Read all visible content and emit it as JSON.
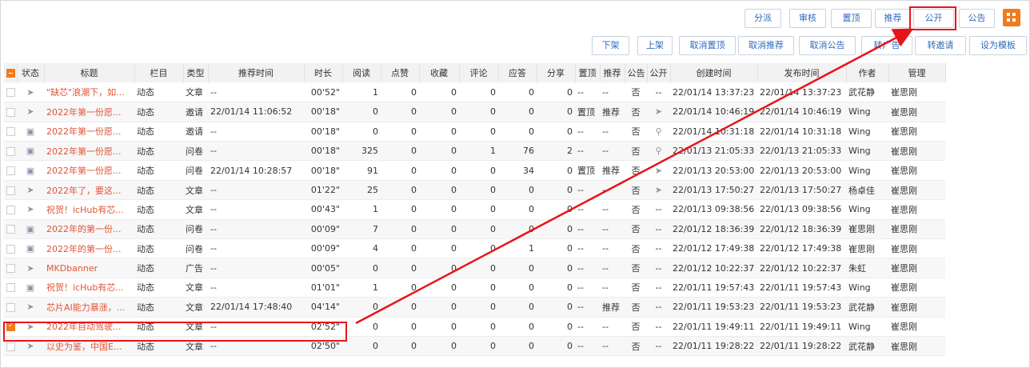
{
  "toolbar_top": [
    "分派",
    "审核",
    "置顶",
    "推荐",
    "公开",
    "公告"
  ],
  "toolbar_bottom": [
    "下架",
    "上架",
    "取消置顶",
    "取消推荐",
    "取消公告",
    "转广告",
    "转邀请",
    "设为模板"
  ],
  "columns": [
    "状态",
    "标题",
    "栏目",
    "类型",
    "推荐时间",
    "时长",
    "阅读",
    "点赞",
    "收藏",
    "评论",
    "应答",
    "分享",
    "置顶",
    "推荐",
    "公告",
    "公开",
    "创建时间",
    "发布时间",
    "作者",
    "管理"
  ],
  "rows": [
    {
      "checked": false,
      "status_icon": "send-icon",
      "title": "\"缺芯\"浪潮下，如...",
      "column": "动态",
      "type": "文章",
      "rec_time": "--",
      "duration": "00'52\"",
      "read": "1",
      "like": "0",
      "fav": "0",
      "comment": "0",
      "answer": "0",
      "share": "0",
      "top": "--",
      "rec": "--",
      "notice": "否",
      "public": "--",
      "created": "22/01/14 13:37:23",
      "published": "22/01/14 13:37:23",
      "author": "武花静",
      "manager": "崔思刚"
    },
    {
      "checked": false,
      "status_icon": "send-icon",
      "title": "2022年第一份愿...",
      "column": "动态",
      "type": "邀请",
      "rec_time": "22/01/14 11:06:52",
      "duration": "00'18\"",
      "read": "0",
      "like": "0",
      "fav": "0",
      "comment": "0",
      "answer": "0",
      "share": "0",
      "top": "置顶",
      "rec": "推荐",
      "notice": "否",
      "public": "send-icon",
      "created": "22/01/14 10:46:19",
      "published": "22/01/14 10:46:19",
      "author": "Wing",
      "manager": "崔思刚"
    },
    {
      "checked": false,
      "status_icon": "flag-icon",
      "title": "2022年第一份愿...",
      "column": "动态",
      "type": "邀请",
      "rec_time": "--",
      "duration": "00'18\"",
      "read": "0",
      "like": "0",
      "fav": "0",
      "comment": "0",
      "answer": "0",
      "share": "0",
      "top": "--",
      "rec": "--",
      "notice": "否",
      "public": "search-icon",
      "created": "22/01/14 10:31:18",
      "published": "22/01/14 10:31:18",
      "author": "Wing",
      "manager": "崔思刚"
    },
    {
      "checked": false,
      "status_icon": "flag-icon",
      "title": "2022年第一份愿...",
      "column": "动态",
      "type": "问卷",
      "rec_time": "--",
      "duration": "00'18\"",
      "read": "325",
      "like": "0",
      "fav": "0",
      "comment": "1",
      "answer": "76",
      "share": "2",
      "top": "--",
      "rec": "--",
      "notice": "否",
      "public": "search-icon",
      "created": "22/01/13 21:05:33",
      "published": "22/01/13 21:05:33",
      "author": "Wing",
      "manager": "崔思刚"
    },
    {
      "checked": false,
      "status_icon": "flag-icon",
      "title": "2022年第一份愿...",
      "column": "动态",
      "type": "问卷",
      "rec_time": "22/01/14 10:28:57",
      "duration": "00'18\"",
      "read": "91",
      "like": "0",
      "fav": "0",
      "comment": "0",
      "answer": "34",
      "share": "0",
      "top": "置顶",
      "rec": "推荐",
      "notice": "否",
      "public": "send-icon",
      "created": "22/01/13 20:53:00",
      "published": "22/01/13 20:53:00",
      "author": "Wing",
      "manager": "崔思刚"
    },
    {
      "checked": false,
      "status_icon": "send-icon",
      "title": "2022年了，要这...",
      "column": "动态",
      "type": "文章",
      "rec_time": "--",
      "duration": "01'22\"",
      "read": "25",
      "like": "0",
      "fav": "0",
      "comment": "0",
      "answer": "0",
      "share": "0",
      "top": "--",
      "rec": "--",
      "notice": "否",
      "public": "send-icon",
      "created": "22/01/13 17:50:27",
      "published": "22/01/13 17:50:27",
      "author": "杨卓佳",
      "manager": "崔思刚"
    },
    {
      "checked": false,
      "status_icon": "send-icon",
      "title": "祝贺！icHub有芯...",
      "column": "动态",
      "type": "文章",
      "rec_time": "--",
      "duration": "00'43\"",
      "read": "1",
      "like": "0",
      "fav": "0",
      "comment": "0",
      "answer": "0",
      "share": "0",
      "top": "--",
      "rec": "--",
      "notice": "否",
      "public": "--",
      "created": "22/01/13 09:38:56",
      "published": "22/01/13 09:38:56",
      "author": "Wing",
      "manager": "崔思刚"
    },
    {
      "checked": false,
      "status_icon": "flag-icon",
      "title": "2022年的第一份...",
      "column": "动态",
      "type": "问卷",
      "rec_time": "--",
      "duration": "00'09\"",
      "read": "7",
      "like": "0",
      "fav": "0",
      "comment": "0",
      "answer": "0",
      "share": "0",
      "top": "--",
      "rec": "--",
      "notice": "否",
      "public": "--",
      "created": "22/01/12 18:36:39",
      "published": "22/01/12 18:36:39",
      "author": "崔思刚",
      "manager": "崔思刚"
    },
    {
      "checked": false,
      "status_icon": "flag-icon",
      "title": "2022年的第一份...",
      "column": "动态",
      "type": "问卷",
      "rec_time": "--",
      "duration": "00'09\"",
      "read": "4",
      "like": "0",
      "fav": "0",
      "comment": "0",
      "answer": "1",
      "share": "0",
      "top": "--",
      "rec": "--",
      "notice": "否",
      "public": "--",
      "created": "22/01/12 17:49:38",
      "published": "22/01/12 17:49:38",
      "author": "崔思刚",
      "manager": "崔思刚"
    },
    {
      "checked": false,
      "status_icon": "send-icon",
      "title": "MKDbanner",
      "column": "动态",
      "type": "广告",
      "rec_time": "--",
      "duration": "00'05\"",
      "read": "0",
      "like": "0",
      "fav": "0",
      "comment": "0",
      "answer": "0",
      "share": "0",
      "top": "--",
      "rec": "--",
      "notice": "否",
      "public": "--",
      "created": "22/01/12 10:22:37",
      "published": "22/01/12 10:22:37",
      "author": "朱虹",
      "manager": "崔思刚"
    },
    {
      "checked": false,
      "status_icon": "flag-icon",
      "title": "祝贺！icHub有芯...",
      "column": "动态",
      "type": "文章",
      "rec_time": "--",
      "duration": "01'01\"",
      "read": "1",
      "like": "0",
      "fav": "0",
      "comment": "0",
      "answer": "0",
      "share": "0",
      "top": "--",
      "rec": "--",
      "notice": "否",
      "public": "--",
      "created": "22/01/11 19:57:43",
      "published": "22/01/11 19:57:43",
      "author": "Wing",
      "manager": "崔思刚"
    },
    {
      "checked": false,
      "status_icon": "send-icon",
      "title": "芯片AI能力暴涨，...",
      "column": "动态",
      "type": "文章",
      "rec_time": "22/01/14 17:48:40",
      "duration": "04'14\"",
      "read": "0",
      "like": "0",
      "fav": "0",
      "comment": "0",
      "answer": "0",
      "share": "0",
      "top": "--",
      "rec": "推荐",
      "notice": "否",
      "public": "--",
      "created": "22/01/11 19:53:23",
      "published": "22/01/11 19:53:23",
      "author": "武花静",
      "manager": "崔思刚"
    },
    {
      "checked": true,
      "status_icon": "send-icon",
      "title": "2022年自动驾驶...",
      "column": "动态",
      "type": "文章",
      "rec_time": "--",
      "duration": "02'52\"",
      "read": "0",
      "like": "0",
      "fav": "0",
      "comment": "0",
      "answer": "0",
      "share": "0",
      "top": "--",
      "rec": "--",
      "notice": "否",
      "public": "--",
      "created": "22/01/11 19:49:11",
      "published": "22/01/11 19:49:11",
      "author": "Wing",
      "manager": "崔思刚"
    },
    {
      "checked": false,
      "status_icon": "send-icon",
      "title": "以史为鉴，中国E...",
      "column": "动态",
      "type": "文章",
      "rec_time": "--",
      "duration": "02'50\"",
      "read": "0",
      "like": "0",
      "fav": "0",
      "comment": "0",
      "answer": "0",
      "share": "0",
      "top": "--",
      "rec": "--",
      "notice": "否",
      "public": "--",
      "created": "22/01/11 19:28:22",
      "published": "22/01/11 19:28:22",
      "author": "武花静",
      "manager": "崔思刚"
    }
  ],
  "colors": {
    "accent": "#f07c1d",
    "link": "#2f6bbd",
    "title": "#e0553a",
    "annotation": "#e8141a"
  }
}
